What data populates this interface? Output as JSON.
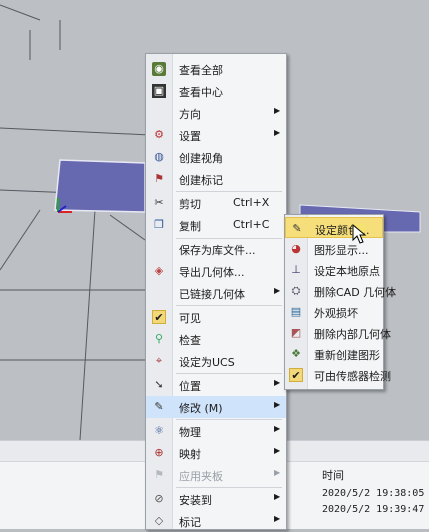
{
  "colors": {
    "menu_bg": "#f4f5f7",
    "highlight_blue": "#cfe3fa",
    "highlight_yellow": "#f6df7a",
    "object_blue": "#6668b0"
  },
  "main_menu": {
    "items": [
      {
        "label": "查看全部",
        "icon": "view-all-icon"
      },
      {
        "label": "查看中心",
        "icon": "view-center-icon"
      },
      {
        "label": "方向",
        "icon": "",
        "submenu": true
      },
      {
        "label": "设置",
        "icon": "settings-icon",
        "submenu": true
      },
      {
        "label": "创建视角",
        "icon": "eye-icon"
      },
      {
        "label": "创建标记",
        "icon": "tag-icon"
      },
      {
        "label": "剪切",
        "shortcut": "Ctrl+X",
        "icon": "scissors-icon"
      },
      {
        "label": "复制",
        "shortcut": "Ctrl+C",
        "icon": "copy-icon"
      },
      {
        "label": "保存为库文件...",
        "icon": ""
      },
      {
        "label": "导出几何体...",
        "icon": "export-icon"
      },
      {
        "label": "已链接几何体",
        "icon": "",
        "submenu": true
      },
      {
        "label": "可见",
        "icon": "check-icon",
        "checked": true
      },
      {
        "label": "检查",
        "icon": "inspect-icon"
      },
      {
        "label": "设定为UCS",
        "icon": "ucs-icon"
      },
      {
        "label": "位置",
        "icon": "arrow-icon",
        "submenu": true
      },
      {
        "label": "修改 (M)",
        "icon": "pencil-icon",
        "submenu": true,
        "highlighted": true
      },
      {
        "label": "物理",
        "icon": "physics-icon",
        "submenu": true
      },
      {
        "label": "映射",
        "icon": "mapping-icon",
        "submenu": true
      },
      {
        "label": "应用夹板",
        "icon": "flag-icon",
        "submenu": true,
        "disabled": true
      },
      {
        "label": "安装到",
        "icon": "mount-icon",
        "submenu": true
      },
      {
        "label": "标记",
        "icon": "label-icon",
        "submenu": true
      }
    ]
  },
  "sub_menu": {
    "items": [
      {
        "label": "设定颜色...",
        "icon": "brush-icon",
        "highlighted": true
      },
      {
        "label": "图形显示...",
        "icon": "display-icon"
      },
      {
        "label": "设定本地原点",
        "icon": "origin-icon"
      },
      {
        "label": "删除CAD 几何体",
        "icon": "delete-cad-icon"
      },
      {
        "label": "外观损坏",
        "icon": "damage-icon"
      },
      {
        "label": "删除内部几何体",
        "icon": "delete-internal-icon"
      },
      {
        "label": "重新创建图形",
        "icon": "recreate-icon"
      },
      {
        "label": "可由传感器检测",
        "icon": "check-icon",
        "checked": true
      }
    ]
  },
  "bottom_panel": {
    "column_time": "时间",
    "timestamps": [
      "2020/5/2 19:38:05",
      "2020/5/2 19:39:47"
    ]
  }
}
